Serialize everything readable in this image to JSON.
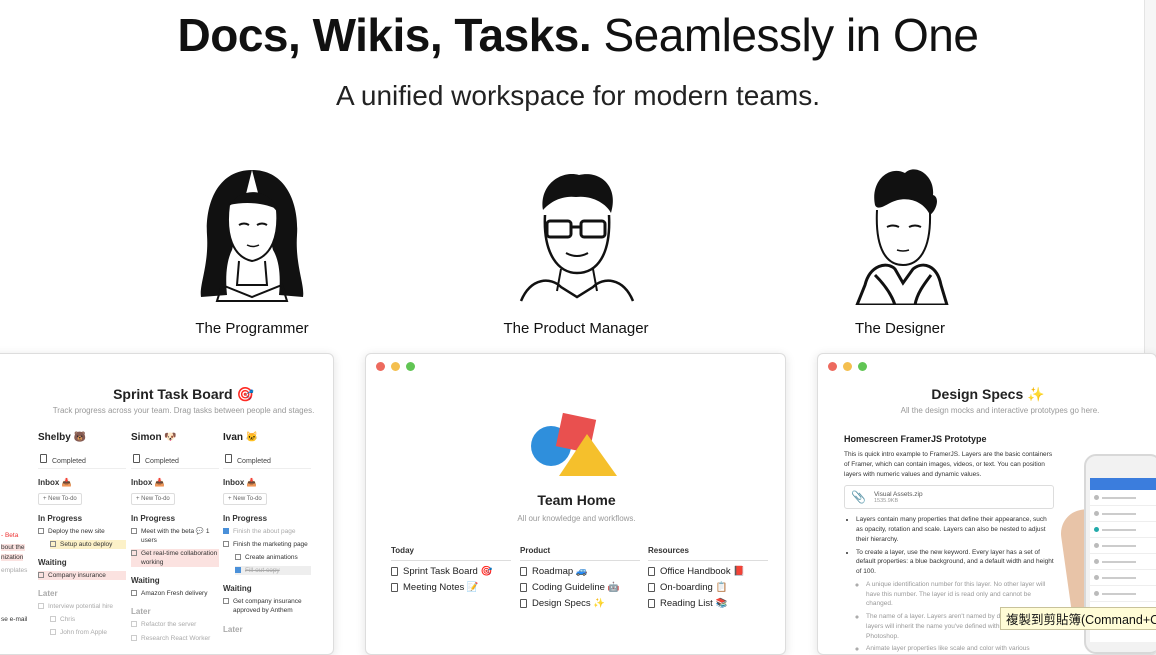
{
  "hero": {
    "title_bold": "Docs, Wikis, Tasks.",
    "title_light": "Seamlessly in One",
    "subtitle": "A unified workspace for modern teams."
  },
  "personas": [
    {
      "name": "The Programmer",
      "icon": "programmer-portrait"
    },
    {
      "name": "The Product Manager",
      "icon": "product-manager-portrait"
    },
    {
      "name": "The Designer",
      "icon": "designer-portrait"
    }
  ],
  "window_dots": {
    "red": "#ed6a5e",
    "yellow": "#f4bf4f",
    "green": "#61c554"
  },
  "sprint": {
    "title": "Sprint Task Board 🎯",
    "desc": "Track progress across your team. Drag tasks between people and stages.",
    "left_fragments": [
      "- Beta",
      "bout the",
      "nization",
      "emplates",
      "se e-mail"
    ],
    "columns": [
      {
        "name": "Shelby 🐻",
        "completed": "Completed",
        "inbox": "Inbox 📥",
        "new_todo": "+ New To-do",
        "in_progress_label": "In Progress",
        "in_progress": [
          {
            "text": "Deploy the new site",
            "style": ""
          },
          {
            "text": "Setup auto deploy",
            "style": "yel"
          }
        ],
        "waiting_label": "Waiting",
        "waiting": [
          {
            "text": "Company insurance",
            "style": "pink"
          }
        ],
        "later_label": "Later",
        "later": [
          {
            "text": "Interview potential hire",
            "style": "grey"
          },
          {
            "text": "Chris",
            "style": "grey"
          },
          {
            "text": "John from Apple",
            "style": "grey"
          }
        ]
      },
      {
        "name": "Simon 🐶",
        "completed": "Completed",
        "inbox": "Inbox 📥",
        "new_todo": "+ New To-do",
        "in_progress_label": "In Progress",
        "in_progress": [
          {
            "text": "Meet with the beta 💬 1 users",
            "style": ""
          },
          {
            "text": "Get real-time collaboration working",
            "style": "pink"
          }
        ],
        "waiting_label": "Waiting",
        "waiting": [
          {
            "text": "Amazon Fresh delivery",
            "style": ""
          }
        ],
        "later_label": "Later",
        "later": [
          {
            "text": "Refactor the server",
            "style": "grey"
          },
          {
            "text": "Research React Worker",
            "style": "grey"
          }
        ]
      },
      {
        "name": "Ivan 🐱",
        "completed": "Completed",
        "inbox": "Inbox 📥",
        "new_todo": "+ New To-do",
        "in_progress_label": "In Progress",
        "in_progress": [
          {
            "text": "Finish the about page",
            "style": "done"
          },
          {
            "text": "Finish the marketing page",
            "style": ""
          },
          {
            "text": "Create animations",
            "style": ""
          },
          {
            "text": "Fill out copy",
            "style": "done"
          }
        ],
        "waiting_label": "Waiting",
        "waiting": [
          {
            "text": "Get company insurance approved by Anthem",
            "style": ""
          }
        ],
        "later_label": "Later",
        "later": []
      }
    ]
  },
  "team": {
    "title": "Team Home",
    "desc": "All our knowledge and workflows.",
    "lists": [
      {
        "header": "Today",
        "items": [
          "Sprint Task Board 🎯",
          "Meeting Notes 📝"
        ]
      },
      {
        "header": "Product",
        "items": [
          "Roadmap 🚙",
          "Coding Guideline 🤖",
          "Design Specs ✨"
        ]
      },
      {
        "header": "Resources",
        "items": [
          "Office Handbook 📕",
          "On-boarding 📋",
          "Reading List 📚"
        ]
      }
    ],
    "logo_colors": {
      "circle": "#2f8fdc",
      "square": "#e9504f",
      "triangle": "#f5c02c"
    }
  },
  "design": {
    "title": "Design Specs ✨",
    "desc": "All the design mocks and interactive prototypes go here.",
    "heading": "Homescreen FramerJS Prototype",
    "intro": "This is quick intro example to FramerJS. Layers are the basic containers of Framer, which can contain images, videos, or text. You can position layers with numeric values and dynamic values.",
    "attachment_name": "Visual Assets.zip",
    "attachment_size": "1535.9KB",
    "bullets": [
      {
        "text": "Layers contain many properties that define their appearance, such as opacity, rotation and scale. Layers can also be nested to adjust their hierarchy.",
        "sub": false
      },
      {
        "text": "To create a layer, use the new keyword. Every layer has a set of default properties: a blue background, and a default width and height of 100.",
        "sub": false
      },
      {
        "text": "A unique identification number for this layer. No other layer will have this number. The layer id is read only and cannot be changed.",
        "sub": true
      },
      {
        "text": "The name of a layer. Layers aren't named by default. Imported layers will inherit the name you've defined within Sketch or Photoshop.",
        "sub": true
      },
      {
        "text": "Animate layer properties like scale and color with various",
        "sub": true
      }
    ]
  },
  "tooltip": "複製到剪貼簿(Command+C)"
}
